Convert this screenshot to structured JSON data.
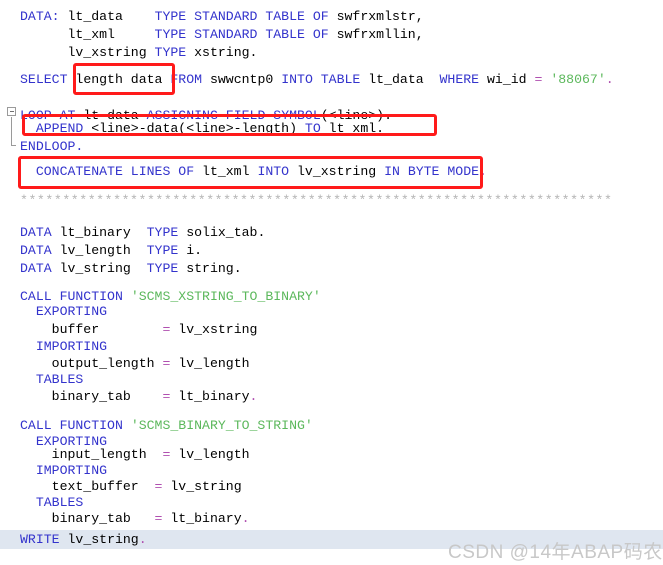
{
  "editor": {
    "language": "ABAP",
    "background_color": "#ffffff",
    "keyword_color": "#3333cc",
    "identifier_color": "#000000",
    "string_color": "#5cb85c",
    "operator_color": "#b050b0",
    "comment_color": "#b4b4b4",
    "current_line_highlight_color": "#dfe6f0",
    "annotation_color": "#ff1a1a"
  },
  "code": {
    "l01_kw_data": "DATA:",
    "l01_id_ltdata": "lt_data",
    "l01_kw_type_standard_table_of": "TYPE STANDARD TABLE OF",
    "l01_id_swfrxmlstr": "swfrxmlstr,",
    "l02_id_ltxml": "lt_xml",
    "l02_kw_type_standard_table_of": "TYPE STANDARD TABLE OF",
    "l02_id_swfrxmllin": "swfrxmllin,",
    "l03_id_lvxstring": "lv_xstring",
    "l03_kw_type": "TYPE",
    "l03_id_xstring": "xstring.",
    "l05_kw_select": "SELECT",
    "l05_id_fields": "length data",
    "l05_kw_from": "FROM",
    "l05_id_swwcntp0": "swwcntp0",
    "l05_kw_into_table": "INTO TABLE",
    "l05_id_ltdata": "lt_data",
    "l05_kw_where": "WHERE",
    "l05_id_wiid": "wi_id",
    "l05_op_eq": "=",
    "l05_str_88067": "'88067'",
    "l05_op_dot": ".",
    "l07_kw_loop_at": "LOOP AT",
    "l07_id_ltdata": "lt data",
    "l07_kw_assigning_field_symbol": "ASSIGNING FIELD-SYMBOL",
    "l07_id_line": "(<line>).",
    "l08_kw_append": "APPEND",
    "l08_id_expr": "<line>-data(<line>-length)",
    "l08_kw_to": "TO",
    "l08_id_ltxml": "lt xml.",
    "l09_kw_endloop": "ENDLOOP.",
    "l11_kw_concatenate_lines_of": "CONCATENATE LINES OF",
    "l11_id_ltxml": "lt_xml",
    "l11_kw_into": "INTO",
    "l11_id_lvxstring": "lv_xstring",
    "l11_kw_in_byte_mode": "IN BYTE MODE",
    "l11_op_dot": ".",
    "l13_comment_ruler": "**********************************************************************",
    "l15_kw_data": "DATA",
    "l15_id_ltbinary": "lt_binary",
    "l15_kw_type": "TYPE",
    "l15_id_solixtab": "solix_tab.",
    "l16_kw_data": "DATA",
    "l16_id_lvlength": "lv_length",
    "l16_kw_type": "TYPE",
    "l16_id_i": "i.",
    "l17_kw_data": "DATA",
    "l17_id_lvstring": "lv_string",
    "l17_kw_type": "TYPE",
    "l17_id_string": "string.",
    "l19_kw_call_function": "CALL FUNCTION",
    "l19_str_fm1": "'SCMS_XSTRING_TO_BINARY'",
    "l20_kw_exporting": "EXPORTING",
    "l21_id_buffer": "buffer",
    "l21_op_eq": "=",
    "l21_id_lvxstring": "lv_xstring",
    "l22_kw_importing": "IMPORTING",
    "l23_id_output_length": "output_length",
    "l23_op_eq": "=",
    "l23_id_lvlength": "lv_length",
    "l24_kw_tables": "TABLES",
    "l25_id_binary_tab": "binary_tab",
    "l25_op_eq": "=",
    "l25_id_ltbinary": "lt_binary",
    "l25_op_dot": ".",
    "l27_kw_call_function": "CALL FUNCTION",
    "l27_str_fm2": "'SCMS_BINARY_TO_STRING'",
    "l28_kw_exporting": "EXPORTING",
    "l29_id_input_length": "input_length",
    "l29_op_eq": "=",
    "l29_id_lvlength": "lv_length",
    "l30_kw_importing": "IMPORTING",
    "l31_id_text_buffer": "text_buffer",
    "l31_op_eq": "=",
    "l31_id_lvstring": "lv_string",
    "l32_kw_tables": "TABLES",
    "l33_id_binary_tab": "binary_tab",
    "l33_op_eq": "=",
    "l33_id_ltbinary": "lt_binary",
    "l33_op_dot": ".",
    "l35_kw_write": "WRITE",
    "l35_id_lvstring": "lv_string",
    "l35_op_dot": "."
  },
  "annotations": {
    "box_select_fields": "length data",
    "box_append_stmt": "APPEND <line>-data(<line>-length) TO lt xml.",
    "box_concatenate_stmt": "CONCATENATE LINES OF lt_xml INTO lv_xstring IN BYTE MODE."
  },
  "watermark": {
    "text": "CSDN @14年ABAP码农"
  }
}
